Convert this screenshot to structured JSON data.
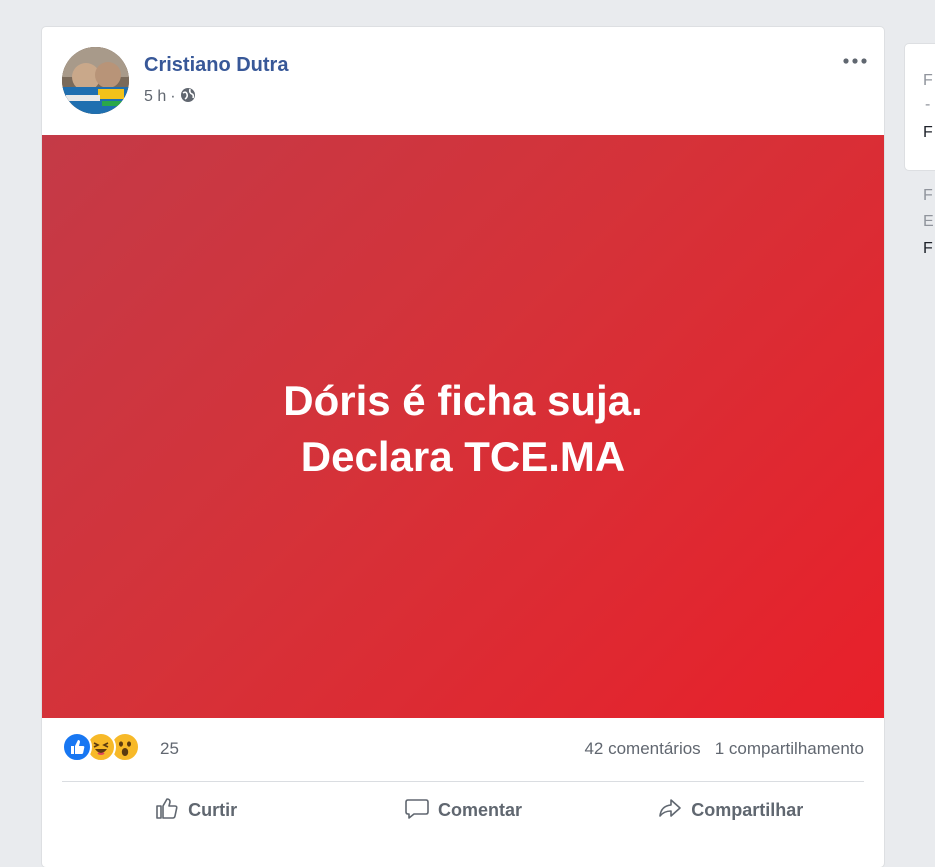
{
  "post": {
    "author": "Cristiano Dutra",
    "time": "5 h",
    "separator": "·",
    "image_text_line1": "Dóris é ficha suja.",
    "image_text_line2": "Declara TCE.MA",
    "reaction_count": "25",
    "comments": "42 comentários",
    "shares": "1 compartilhamento",
    "reactions": [
      "like-icon",
      "haha-icon",
      "wow-icon"
    ]
  },
  "actions": {
    "like": "Curtir",
    "comment": "Comentar",
    "share": "Compartilhar"
  },
  "sidebar": {
    "line1": "F",
    "line2": "-",
    "line3": "F",
    "line4": "F",
    "line5": "E",
    "line6": "F"
  },
  "colors": {
    "link": "#385898",
    "post_bg_start": "#c43a47",
    "post_bg_end": "#e8202a",
    "like_blue": "#1877f2",
    "emoji_yellow": "#f7b928"
  }
}
